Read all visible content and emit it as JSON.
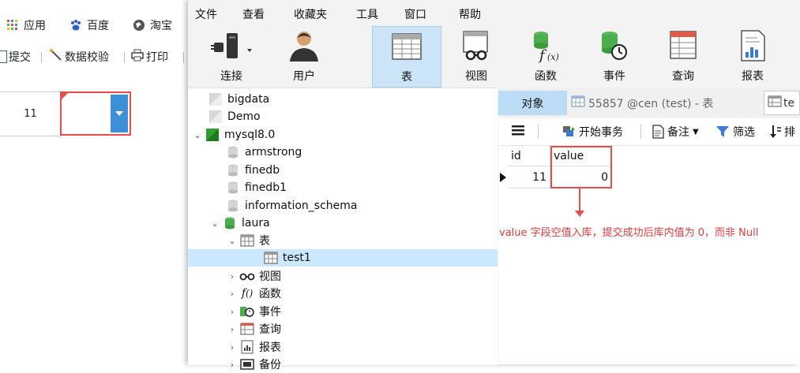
{
  "browser": {
    "bookmarks": [
      {
        "label": "应用",
        "icon": "apps-grid-icon"
      },
      {
        "label": "百度",
        "icon": "baidu-paw-icon"
      },
      {
        "label": "淘宝",
        "icon": "globe-icon"
      }
    ],
    "report_toolbar": {
      "submit_label": "提交",
      "validate_label": "数据校验",
      "print_label": "打印"
    },
    "grid": {
      "id_value": "11",
      "value_cell": ""
    }
  },
  "navicat": {
    "menu": [
      "文件",
      "查看",
      "收藏夹",
      "工具",
      "窗口",
      "帮助"
    ],
    "toolbar": [
      {
        "label": "连接",
        "icon": "connection-icon"
      },
      {
        "label": "用户",
        "icon": "user-icon"
      },
      {
        "label": "表",
        "icon": "table-icon"
      },
      {
        "label": "视图",
        "icon": "view-icon"
      },
      {
        "label": "函数",
        "icon": "function-icon"
      },
      {
        "label": "事件",
        "icon": "event-icon"
      },
      {
        "label": "查询",
        "icon": "query-icon"
      },
      {
        "label": "报表",
        "icon": "report-icon"
      }
    ],
    "tree": {
      "bigdata": "bigdata",
      "demo": "Demo",
      "mysql8": "mysql8.0",
      "armstrong": "armstrong",
      "finedb": "finedb",
      "finedb1": "finedb1",
      "information_schema": "information_schema",
      "laura": "laura",
      "tables": "表",
      "test1": "test1",
      "views": "视图",
      "functions": "函数",
      "events": "事件",
      "queries": "查询",
      "reports": "报表",
      "backup": "备份"
    },
    "tabs": {
      "objects": "对象",
      "test_tab": "55857 @cen (test) - 表",
      "second_tab": "te"
    },
    "subtoolbar": {
      "begin_transaction": "开始事务",
      "memo": "备注",
      "filter": "筛选",
      "sort": "排"
    },
    "datagrid": {
      "columns": [
        "id",
        "value"
      ],
      "rows": [
        {
          "id": "11",
          "value": "0"
        }
      ]
    }
  },
  "annotation": "value 字段空值入库，提交成功后库内值为 0，而非 Null",
  "colors": {
    "accent_red": "#e84d4d",
    "selection_blue": "#cce8ff",
    "toolbar_active": "#cce4f7"
  }
}
